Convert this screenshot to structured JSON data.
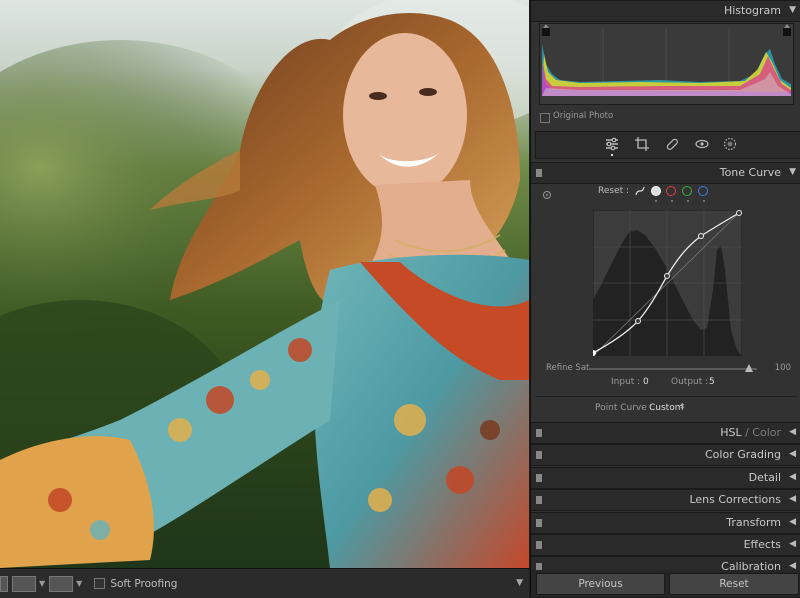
{
  "toolbar": {
    "soft_proofing_label": "Soft Proofing"
  },
  "panels": {
    "histogram": {
      "title": "Histogram",
      "original_photo_label": "Original Photo"
    },
    "tone_curve": {
      "title": "Tone Curve",
      "reset_label": "Reset :",
      "refine_saturation_label": "Refine Sat.",
      "refine_saturation_value": "100",
      "refine_saturation_level": 0.95,
      "input_label": "Input :",
      "input_value": "0",
      "output_label": "Output :",
      "output_value": "5",
      "point_curve_label": "Point Curve :",
      "point_curve_value": "Custom",
      "channels": [
        {
          "name": "parametric",
          "color": "#d9d9d9"
        },
        {
          "name": "rgb",
          "color": "#d9d9d9"
        },
        {
          "name": "red",
          "color": "#e04040"
        },
        {
          "name": "green",
          "color": "#3cb043"
        },
        {
          "name": "blue",
          "color": "#3d7be0"
        }
      ]
    },
    "collapsed": [
      {
        "title": "HSL",
        "suffix": " / Color"
      },
      {
        "title": "Color Grading",
        "suffix": ""
      },
      {
        "title": "Detail",
        "suffix": ""
      },
      {
        "title": "Lens Corrections",
        "suffix": ""
      },
      {
        "title": "Transform",
        "suffix": ""
      },
      {
        "title": "Effects",
        "suffix": ""
      },
      {
        "title": "Calibration",
        "suffix": ""
      }
    ]
  },
  "buttons": {
    "previous": "Previous",
    "reset": "Reset"
  },
  "colors": {
    "panel_bg": "#323232",
    "header_bg": "#2a2a2a",
    "accent_red": "#e04040",
    "accent_green": "#3cb043",
    "accent_blue": "#3d7be0"
  }
}
